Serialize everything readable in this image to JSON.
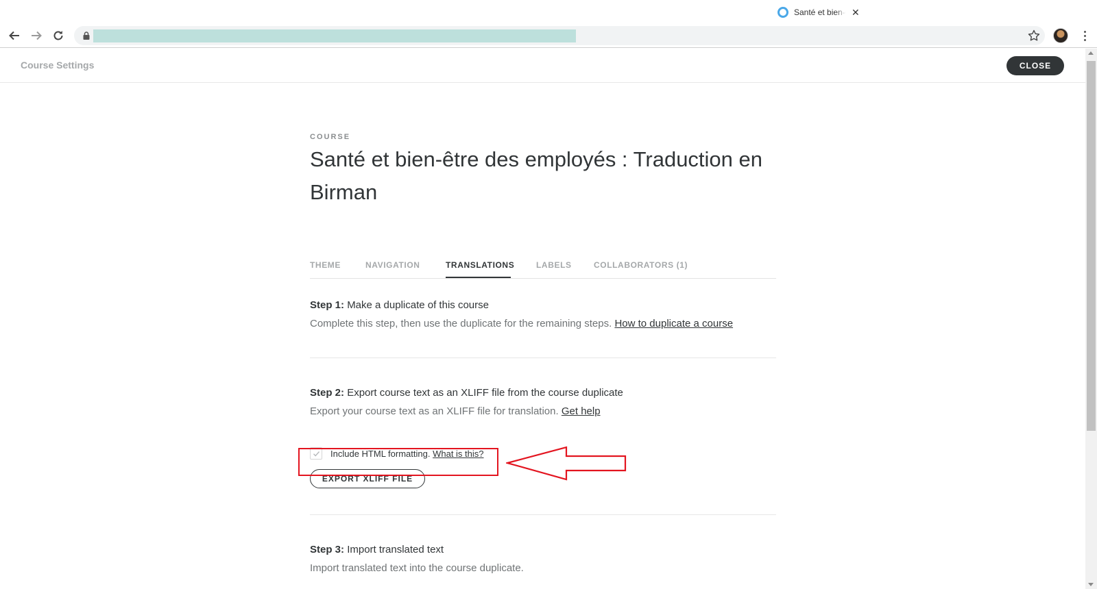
{
  "browser": {
    "tab_title": "Santé et bien-être des employés",
    "colors": {
      "tab_favicon": "#4aa8e8",
      "url_redaction": "#bde0dc"
    }
  },
  "header": {
    "title": "Course Settings",
    "close_label": "CLOSE"
  },
  "course": {
    "eyebrow": "COURSE",
    "title": "Santé et bien-être des employés : Traduction en Birman"
  },
  "tabs": [
    {
      "label": "THEME",
      "active": false
    },
    {
      "label": "NAVIGATION",
      "active": false
    },
    {
      "label": "TRANSLATIONS",
      "active": true
    },
    {
      "label": "LABELS",
      "active": false
    },
    {
      "label": "COLLABORATORS (1)",
      "active": false
    }
  ],
  "steps": [
    {
      "label": "Step 1:",
      "heading": "Make a duplicate of this course",
      "description": "Complete this step, then use the duplicate for the remaining steps.",
      "link": "How to duplicate a course"
    },
    {
      "label": "Step 2:",
      "heading": "Export course text as an XLIFF file from the course duplicate",
      "description": "Export your course text as an XLIFF file for translation.",
      "link": "Get help",
      "checkbox": {
        "label": "Include HTML formatting.",
        "link": "What is this?",
        "checked": true
      },
      "button": "EXPORT XLIFF FILE"
    },
    {
      "label": "Step 3:",
      "heading": "Import translated text",
      "description": "Import translated text into the course duplicate."
    }
  ],
  "annotation": {
    "color": "#e3141f"
  }
}
